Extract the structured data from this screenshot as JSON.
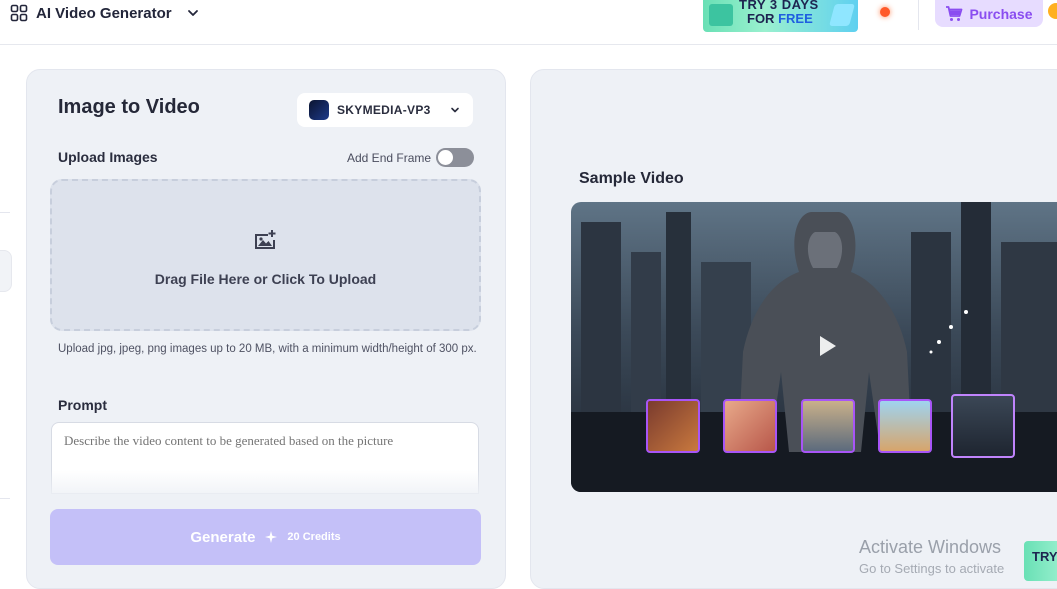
{
  "header": {
    "app_title": "AI Video Generator",
    "promo_line1": "TRY 3 DAYS",
    "promo_line2_a": "FOR",
    "promo_line2_b": "FREE",
    "purchase_label": "Purchase"
  },
  "left": {
    "title": "Image to Video",
    "model": "SKYMEDIA-VP3",
    "upload_label": "Upload Images",
    "end_frame_label": "Add End Frame",
    "end_frame_enabled": false,
    "dropzone_text": "Drag File Here or Click To Upload",
    "upload_hint": "Upload jpg, jpeg, png images up to 20 MB, with a minimum width/height of 300 px.",
    "prompt_label": "Prompt",
    "prompt_placeholder": "Describe the video content to be generated based on the picture",
    "prompt_value": "",
    "generate_label": "Generate",
    "credits_label": "20 Credits"
  },
  "right": {
    "sample_title": "Sample Video",
    "thumbnails": [
      "boxing",
      "girl",
      "car",
      "child-city",
      "robot"
    ],
    "active_thumbnail": 4
  },
  "overlay": {
    "activate_line1": "Activate Windows",
    "activate_line2": "Go to Settings to activate",
    "promo_corner": "TRY"
  },
  "colors": {
    "accent": "#8a4df0",
    "generate_bg": "#c4c0f8",
    "panel_bg": "#eef1f6",
    "thumb_border": "#a855f7"
  },
  "icons": [
    "grid-apps-icon",
    "chevron-down-icon",
    "cart-icon",
    "image-add-icon",
    "sparkle-icon",
    "play-icon"
  ]
}
